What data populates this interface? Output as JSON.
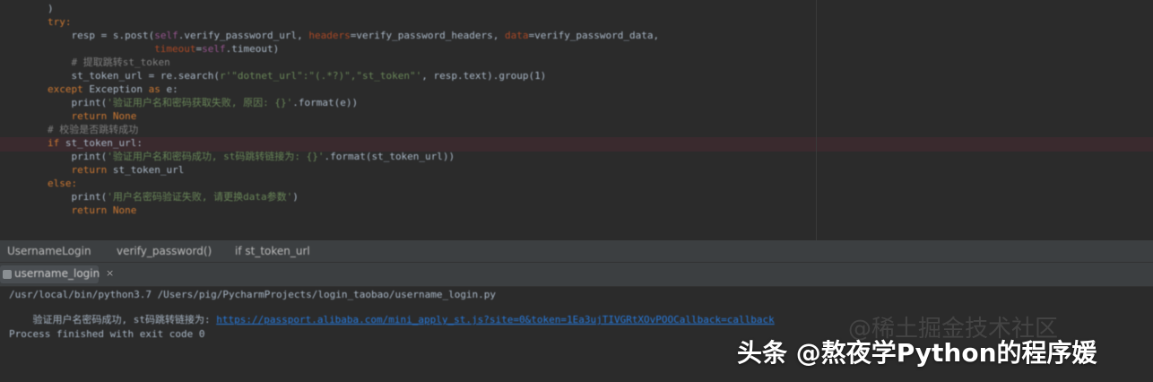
{
  "colors": {
    "editor_bg": "#2b2b2b",
    "keyword": "#cc7832",
    "string": "#6a8759",
    "comment": "#808080",
    "self": "#94558d",
    "link": "#287bde",
    "panel_bg": "#3c3f41"
  },
  "editor": {
    "lines": [
      {
        "indent": "        ",
        "parts": [
          {
            "t": ")",
            "c": "var"
          }
        ]
      },
      {
        "indent": "        ",
        "parts": [
          {
            "t": "try:",
            "c": "kw"
          }
        ]
      },
      {
        "indent": "            ",
        "parts": [
          {
            "t": "resp = s.post(",
            "c": "var"
          },
          {
            "t": "self",
            "c": "self"
          },
          {
            "t": ".verify_password_url, ",
            "c": "var"
          },
          {
            "t": "headers",
            "c": "prm"
          },
          {
            "t": "=verify_password_headers, ",
            "c": "var"
          },
          {
            "t": "data",
            "c": "prm"
          },
          {
            "t": "=verify_password_data,",
            "c": "var"
          }
        ]
      },
      {
        "indent": "                          ",
        "parts": [
          {
            "t": "timeout",
            "c": "prm"
          },
          {
            "t": "=",
            "c": "var"
          },
          {
            "t": "self",
            "c": "self"
          },
          {
            "t": ".timeout)",
            "c": "var"
          }
        ]
      },
      {
        "indent": "            ",
        "parts": [
          {
            "t": "# 提取跳转st_token",
            "c": "cmt"
          }
        ]
      },
      {
        "indent": "            ",
        "parts": [
          {
            "t": "st_token_url = re.search(",
            "c": "var"
          },
          {
            "t": "r'\"dotnet_url\":\"(.*?)\",\"st_token\"'",
            "c": "str"
          },
          {
            "t": ", resp.text).group(1)",
            "c": "var"
          }
        ]
      },
      {
        "indent": "        ",
        "parts": [
          {
            "t": "except ",
            "c": "kw"
          },
          {
            "t": "Exception ",
            "c": "var"
          },
          {
            "t": "as ",
            "c": "kw"
          },
          {
            "t": "e:",
            "c": "var"
          }
        ]
      },
      {
        "indent": "            ",
        "parts": [
          {
            "t": "print(",
            "c": "fn"
          },
          {
            "t": "'验证用户名和密码获取失败, 原因: {}'",
            "c": "str"
          },
          {
            "t": ".format(e))",
            "c": "var"
          }
        ]
      },
      {
        "indent": "            ",
        "parts": [
          {
            "t": "return None",
            "c": "kw"
          }
        ]
      },
      {
        "indent": "        ",
        "parts": [
          {
            "t": "# 校验是否跳转成功",
            "c": "cmt"
          }
        ]
      },
      {
        "indent": "        ",
        "parts": [
          {
            "t": "if ",
            "c": "kw"
          },
          {
            "t": "st_token_url:",
            "c": "var"
          }
        ]
      },
      {
        "indent": "            ",
        "parts": [
          {
            "t": "print(",
            "c": "fn"
          },
          {
            "t": "'验证用户名和密码成功, st码跳转链接为: {}'",
            "c": "str"
          },
          {
            "t": ".format(st_token_url))",
            "c": "var"
          }
        ]
      },
      {
        "indent": "            ",
        "parts": [
          {
            "t": "return ",
            "c": "kw"
          },
          {
            "t": "st_token_url",
            "c": "var"
          }
        ]
      },
      {
        "indent": "        ",
        "parts": [
          {
            "t": "else:",
            "c": "kw"
          }
        ]
      },
      {
        "indent": "            ",
        "parts": [
          {
            "t": "print(",
            "c": "fn"
          },
          {
            "t": "'用户名密码验证失败, 请更换data参数'",
            "c": "str"
          },
          {
            "t": ")",
            "c": "var"
          }
        ]
      },
      {
        "indent": "            ",
        "parts": [
          {
            "t": "return None",
            "c": "kw"
          }
        ]
      }
    ]
  },
  "breadcrumbs": [
    "UsernameLogin",
    "verify_password()",
    "if st_token_url"
  ],
  "run": {
    "tab_label": "username_login",
    "close_glyph": "×"
  },
  "console": {
    "command": "/usr/local/bin/python3.7 /Users/pig/PycharmProjects/login_taobao/username_login.py",
    "result_prefix": "验证用户名密码成功, st码跳转链接为: ",
    "result_link": "https://passport.alibaba.com/mini_apply_st.js?site=0&token=1Ea3ujTIVGRtXOvPOOCallback=callback",
    "exit": "Process finished with exit code 0"
  },
  "watermark": {
    "faint": "@稀土掘金技术社区",
    "main": "头条 @熬夜学Python的程序媛"
  }
}
